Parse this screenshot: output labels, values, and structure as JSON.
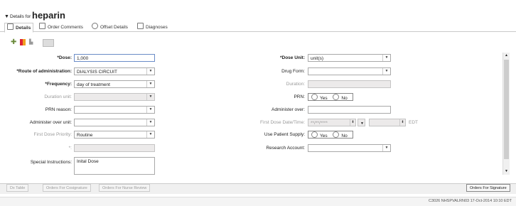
{
  "header": {
    "prefix": "Details for",
    "drug": "heparin"
  },
  "tabs": [
    {
      "label": "Details",
      "icon": "details-icon"
    },
    {
      "label": "Order Comments",
      "icon": "comment-icon"
    },
    {
      "label": "Offset Details",
      "icon": "clock-icon"
    },
    {
      "label": "Diagnoses",
      "icon": "diagnosis-icon"
    }
  ],
  "form": {
    "dose": {
      "label": "*Dose:",
      "value": "1,000"
    },
    "dose_unit": {
      "label": "*Dose Unit:",
      "value": "unit(s)"
    },
    "route": {
      "label": "*Route of administration:",
      "value": "DIALYSIS CIRCUIT"
    },
    "drug_form": {
      "label": "Drug Form:",
      "value": ""
    },
    "frequency": {
      "label": "*Frequency:",
      "value": "day of treatment"
    },
    "duration": {
      "label": "Duration:",
      "value": ""
    },
    "duration_unit": {
      "label": "Duration unit:",
      "value": ""
    },
    "prn": {
      "label": "PRN:",
      "yes": "Yes",
      "no": "No"
    },
    "prn_reason": {
      "label": "PRN reason:",
      "value": ""
    },
    "administer_over": {
      "label": "Administer over:",
      "value": ""
    },
    "administer_over_unit": {
      "label": "Administer over unit:",
      "value": ""
    },
    "first_dose_dt": {
      "label": "First Dose Date/Time:",
      "value": "**/**/****",
      "tz": "EDT"
    },
    "first_dose_priority": {
      "label": "First Dose Priority:",
      "value": "Routine"
    },
    "use_patient_supply": {
      "label": "Use Patient Supply:",
      "yes": "Yes",
      "no": "No"
    },
    "asterisk_field": {
      "label": "*:",
      "value": ""
    },
    "research_account": {
      "label": "Research Account:",
      "value": ""
    },
    "special_instructions": {
      "label": "Special Instructions:",
      "value": "Inital Dose"
    }
  },
  "bottom_buttons": {
    "dx_table": "Dx Table",
    "orders_cosignature": "Orders For Cosignature",
    "orders_nurse_review": "Orders For Nurse Review",
    "orders_signature": "Orders For Signature"
  },
  "status": {
    "text": "C3026   NHSPVALRN03   17-Oct-2014   10:10 EDT"
  }
}
